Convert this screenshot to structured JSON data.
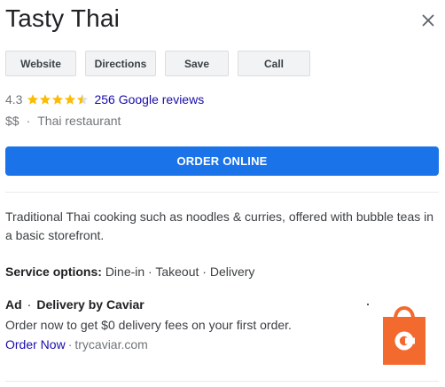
{
  "business": {
    "name": "Tasty Thai",
    "rating": "4.3",
    "stars": 4.5,
    "reviews_label": "256 Google reviews",
    "price": "$$",
    "category": "Thai restaurant",
    "description": "Traditional Thai cooking such as noodles & curries, offered with bubble teas in a basic storefront."
  },
  "actions": {
    "website": "Website",
    "directions": "Directions",
    "save": "Save",
    "call": "Call"
  },
  "order": {
    "label": "ORDER ONLINE"
  },
  "service_options": {
    "label": "Service options:",
    "value": "Dine-in · Takeout · Delivery"
  },
  "ad": {
    "label": "Ad",
    "separator": "·",
    "title": "Delivery by Caviar",
    "body": "Order now to get $0 delivery fees on your first order.",
    "link": "Order Now",
    "domain": "trycaviar.com"
  },
  "icons": {
    "close": "close-icon",
    "star": "star-icon",
    "bag": "caviar-bag-icon"
  },
  "colors": {
    "accent": "#1a73e8",
    "star": "#fbbc04",
    "link": "#1a0dab",
    "caviar": "#f26a2e"
  }
}
